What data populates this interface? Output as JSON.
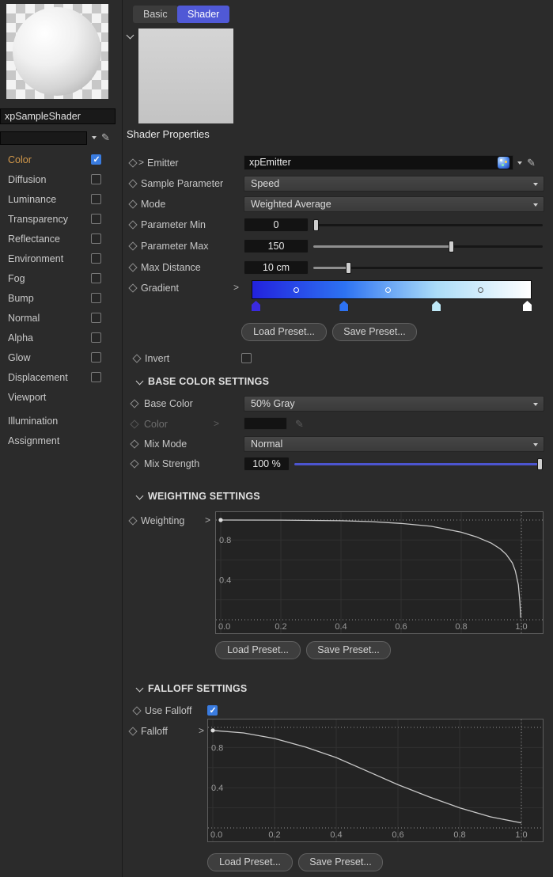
{
  "sidebar": {
    "material_name": "xpSampleShader",
    "channels": [
      {
        "label": "Color",
        "checked": true
      },
      {
        "label": "Diffusion",
        "checked": false
      },
      {
        "label": "Luminance",
        "checked": false
      },
      {
        "label": "Transparency",
        "checked": false
      },
      {
        "label": "Reflectance",
        "checked": false
      },
      {
        "label": "Environment",
        "checked": false
      },
      {
        "label": "Fog",
        "checked": false
      },
      {
        "label": "Bump",
        "checked": false
      },
      {
        "label": "Normal",
        "checked": false
      },
      {
        "label": "Alpha",
        "checked": false
      },
      {
        "label": "Glow",
        "checked": false
      },
      {
        "label": "Displacement",
        "checked": false
      }
    ],
    "pages": [
      "Viewport",
      "Illumination",
      "Assignment"
    ]
  },
  "tabs": {
    "basic": "Basic",
    "shader": "Shader",
    "active": "Shader"
  },
  "header": {
    "title": "Shader Properties"
  },
  "properties": {
    "emitter": {
      "label": "Emitter",
      "value": "xpEmitter"
    },
    "sample_parameter": {
      "label": "Sample Parameter",
      "value": "Speed"
    },
    "mode": {
      "label": "Mode",
      "value": "Weighted Average"
    },
    "parameter_min": {
      "label": "Parameter Min",
      "value": "0",
      "slider_pct": 1
    },
    "parameter_max": {
      "label": "Parameter Max",
      "value": "150",
      "slider_pct": 60
    },
    "max_distance": {
      "label": "Max Distance",
      "value": "10 cm",
      "slider_pct": 15
    },
    "gradient": {
      "label": "Gradient",
      "stops": [
        {
          "pos": 0,
          "color": "#2222dd"
        },
        {
          "pos": 33,
          "color": "#2d72f2"
        },
        {
          "pos": 66,
          "color": "#aadcf8"
        },
        {
          "pos": 100,
          "color": "#ffffff"
        }
      ],
      "bias_markers": [
        {
          "pos": 16,
          "ring": "#ffffff"
        },
        {
          "pos": 49,
          "ring": "#ffffff"
        },
        {
          "pos": 82,
          "ring": "#5a5a5a"
        }
      ],
      "knots": [
        {
          "pos": 0,
          "color": "#3a2ae0"
        },
        {
          "pos": 33,
          "color": "#2d72f2"
        },
        {
          "pos": 66,
          "color": "#bfe9f7"
        },
        {
          "pos": 100,
          "color": "#ffffff"
        }
      ]
    },
    "invert": {
      "label": "Invert",
      "checked": false
    },
    "load_preset": "Load Preset...",
    "save_preset": "Save Preset..."
  },
  "base_color": {
    "title": "BASE COLOR SETTINGS",
    "base_color": {
      "label": "Base Color",
      "value": "50% Gray"
    },
    "color": {
      "label": "Color"
    },
    "mix_mode": {
      "label": "Mix Mode",
      "value": "Normal"
    },
    "mix_strength": {
      "label": "Mix Strength",
      "value": "100 %",
      "slider_pct": 100
    }
  },
  "weighting": {
    "title": "WEIGHTING SETTINGS",
    "label": "Weighting",
    "graph": {
      "x_ticks": [
        "0.0",
        "0.2",
        "0.4",
        "0.6",
        "0.8",
        "1.0"
      ],
      "y_ticks": [
        "0.8",
        "0.4"
      ],
      "points": [
        [
          0,
          1
        ],
        [
          0.2,
          0.999
        ],
        [
          0.4,
          0.993
        ],
        [
          0.5,
          0.984
        ],
        [
          0.6,
          0.966
        ],
        [
          0.7,
          0.937
        ],
        [
          0.8,
          0.878
        ],
        [
          0.85,
          0.832
        ],
        [
          0.9,
          0.768
        ],
        [
          0.93,
          0.71
        ],
        [
          0.95,
          0.655
        ],
        [
          0.97,
          0.57
        ],
        [
          0.98,
          0.49
        ],
        [
          0.99,
          0.35
        ],
        [
          0.995,
          0.18
        ],
        [
          0.998,
          0.02
        ]
      ]
    },
    "load_preset": "Load Preset...",
    "save_preset": "Save Preset..."
  },
  "falloff": {
    "title": "FALLOFF SETTINGS",
    "use_falloff": {
      "label": "Use Falloff",
      "checked": true
    },
    "label": "Falloff",
    "graph": {
      "x_ticks": [
        "0.0",
        "0.2",
        "0.4",
        "0.6",
        "0.8",
        "1.0"
      ],
      "y_ticks": [
        "0.8",
        "0.4"
      ],
      "points": [
        [
          0,
          0.97
        ],
        [
          0.1,
          0.945
        ],
        [
          0.2,
          0.89
        ],
        [
          0.3,
          0.805
        ],
        [
          0.4,
          0.7
        ],
        [
          0.5,
          0.565
        ],
        [
          0.6,
          0.43
        ],
        [
          0.7,
          0.31
        ],
        [
          0.8,
          0.2
        ],
        [
          0.9,
          0.11
        ],
        [
          1,
          0.05
        ]
      ]
    },
    "load_preset": "Load Preset...",
    "save_preset": "Save Preset..."
  },
  "colors": {
    "tab_active": "#5059d6",
    "checkbox_checked": "#3a7ce0",
    "color_channel_label": "#d2984a",
    "mix_slider_fill": "#4c55d0",
    "graph_bg": "#232323"
  }
}
